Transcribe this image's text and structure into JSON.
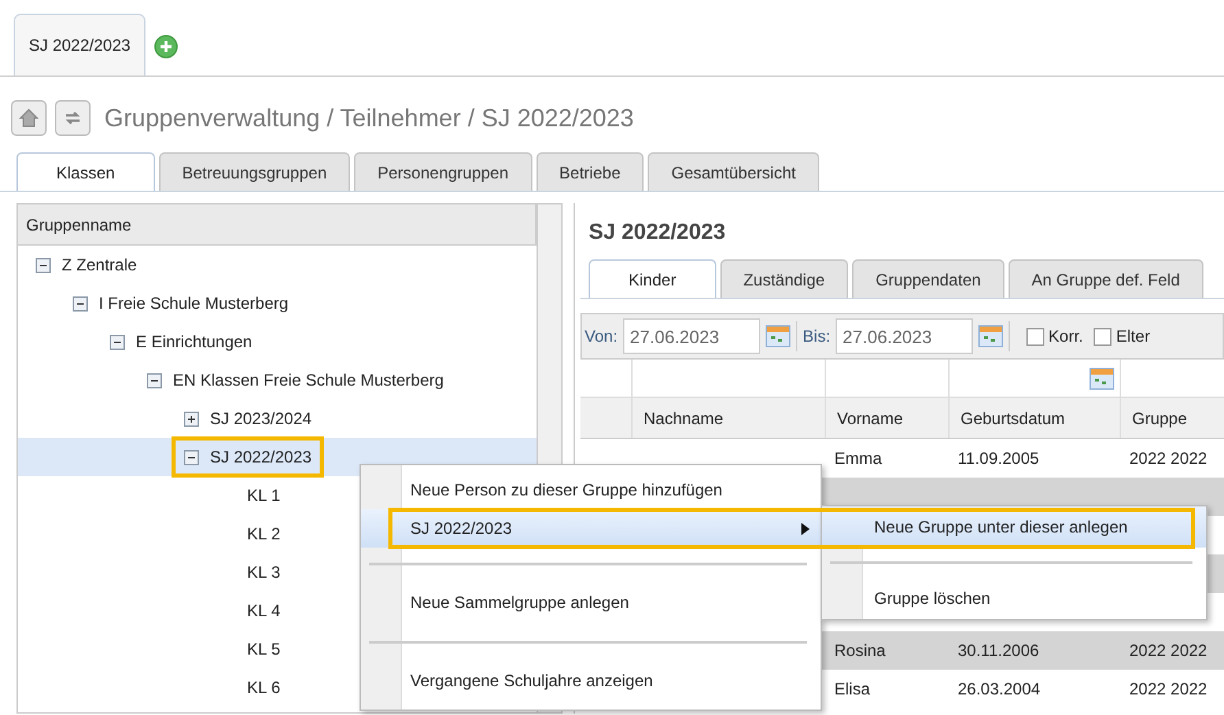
{
  "doc_tabs": [
    {
      "label": "SJ 2022/2023",
      "selected": true
    }
  ],
  "breadcrumb": "Gruppenverwaltung / Teilnehmer / SJ 2022/2023",
  "main_tabs": [
    {
      "label": "Klassen",
      "selected": true
    },
    {
      "label": "Betreuungsgruppen",
      "selected": false
    },
    {
      "label": "Personengruppen",
      "selected": false
    },
    {
      "label": "Betriebe",
      "selected": false
    },
    {
      "label": "Gesamtübersicht",
      "selected": false
    }
  ],
  "tree": {
    "header": "Gruppenname",
    "items": [
      {
        "label": "Z Zentrale",
        "expanded": true,
        "selected": false,
        "highlighted": false,
        "children": [
          {
            "label": "I Freie Schule Musterberg",
            "expanded": true,
            "selected": false,
            "highlighted": false,
            "children": [
              {
                "label": "E Einrichtungen",
                "expanded": true,
                "selected": false,
                "highlighted": false,
                "children": [
                  {
                    "label": "EN Klassen Freie Schule Musterberg",
                    "expanded": true,
                    "selected": false,
                    "highlighted": false,
                    "children": [
                      {
                        "label": "SJ 2023/2024",
                        "expanded": false,
                        "selected": false,
                        "highlighted": false
                      },
                      {
                        "label": "SJ 2022/2023",
                        "expanded": true,
                        "selected": true,
                        "highlighted": true,
                        "children": [
                          {
                            "label": "KL 1"
                          },
                          {
                            "label": "KL 2"
                          },
                          {
                            "label": "KL 3"
                          },
                          {
                            "label": "KL 4"
                          },
                          {
                            "label": "KL 5"
                          },
                          {
                            "label": "KL 6"
                          }
                        ]
                      }
                    ]
                  }
                ]
              }
            ]
          }
        ]
      }
    ]
  },
  "detail": {
    "title": "SJ 2022/2023",
    "tabs": [
      {
        "label": "Kinder",
        "selected": true
      },
      {
        "label": "Zuständige",
        "selected": false
      },
      {
        "label": "Gruppendaten",
        "selected": false
      },
      {
        "label": "An Gruppe def. Feld",
        "selected": false
      }
    ],
    "von_label": "Von:",
    "von": "27.06.2023",
    "bis_label": "Bis:",
    "bis": "27.06.2023",
    "checkboxes": [
      {
        "label": "Korr.",
        "checked": false
      },
      {
        "label": "Elter",
        "checked": false
      }
    ],
    "columns": [
      "Nachname",
      "Vorname",
      "Geburtsdatum",
      "Gruppe"
    ],
    "rows": [
      {
        "vorname": "Emma",
        "geburtsdatum": "11.09.2005",
        "gruppe": "2022 2022"
      },
      {},
      {},
      {},
      {},
      {
        "vorname": "Rosina",
        "geburtsdatum": "30.11.2006",
        "gruppe": "2022 2022"
      },
      {
        "vorname": "Elisa",
        "geburtsdatum": "26.03.2004",
        "gruppe": "2022 2022"
      }
    ]
  },
  "context_menu": {
    "items": [
      {
        "kind": "item",
        "label": "Neue Person zu dieser Gruppe hinzufügen",
        "selected": false
      },
      {
        "kind": "submenu",
        "label": "SJ 2022/2023",
        "selected": true,
        "highlighted": true,
        "submenu": [
          {
            "kind": "item",
            "label": "Neue Gruppe unter dieser anlegen",
            "selected": true
          },
          {
            "kind": "separator"
          },
          {
            "kind": "item",
            "label": "Gruppe löschen",
            "selected": false
          }
        ]
      },
      {
        "kind": "separator"
      },
      {
        "kind": "item",
        "label": "Neue Sammelgruppe anlegen",
        "selected": false
      },
      {
        "kind": "separator"
      },
      {
        "kind": "item",
        "label": "Vergangene Schuljahre anzeigen",
        "selected": false
      }
    ]
  }
}
